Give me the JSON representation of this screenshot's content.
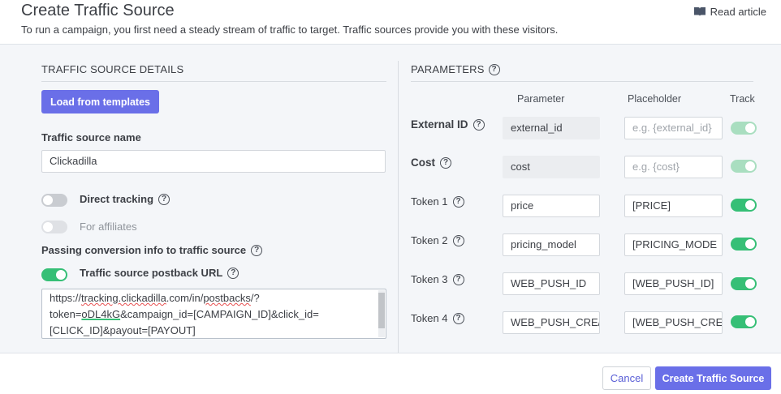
{
  "header": {
    "title": "Create Traffic Source",
    "subtitle": "To run a campaign, you first need a steady stream of traffic to target. Traffic sources provide you with these visitors.",
    "read_article": "Read article"
  },
  "details": {
    "section_title": "TRAFFIC SOURCE DETAILS",
    "load_button": "Load from templates",
    "name_label": "Traffic source name",
    "name_value": "Clickadilla",
    "direct_tracking_label": "Direct tracking",
    "for_affiliates_label": "For affiliates",
    "passing_label": "Passing conversion info to traffic source",
    "postback_label": "Traffic source postback URL",
    "postback_url": {
      "p1": "https://",
      "p2": "tracking.clickadilla",
      "p3": ".com/in/",
      "p4": "postbacks",
      "p5": "/?",
      "p6": "token=",
      "p7": "oDL4kG",
      "p8": "&campaign_id=[CAMPAIGN_ID]&click_id=",
      "p9": "[CLICK_ID]&payout=[PAYOUT]"
    },
    "toggles": {
      "direct_tracking": false,
      "for_affiliates": false,
      "postback": true
    }
  },
  "parameters": {
    "section_title": "PARAMETERS",
    "col_parameter": "Parameter",
    "col_placeholder": "Placeholder",
    "col_track": "Track",
    "rows": [
      {
        "label": "External ID",
        "parameter": "external_id",
        "placeholder": "",
        "placeholder_hint": "e.g. {external_id}",
        "track": true
      },
      {
        "label": "Cost",
        "parameter": "cost",
        "placeholder": "",
        "placeholder_hint": "e.g. {cost}",
        "track": true
      },
      {
        "label": "Token 1",
        "parameter": "price",
        "placeholder": "[PRICE]",
        "track": true
      },
      {
        "label": "Token 2",
        "parameter": "pricing_model",
        "placeholder": "[PRICING_MODE",
        "track": true
      },
      {
        "label": "Token 3",
        "parameter": "WEB_PUSH_ID",
        "placeholder": "[WEB_PUSH_ID]",
        "track": true
      },
      {
        "label": "Token 4",
        "parameter": "WEB_PUSH_CRE/",
        "placeholder": "[WEB_PUSH_CRE",
        "track": true
      }
    ]
  },
  "footer": {
    "cancel": "Cancel",
    "create": "Create Traffic Source"
  },
  "colors": {
    "primary": "#6a6fe8",
    "toggle_on": "#36bf76",
    "toggle_off": "#c9ccd1",
    "background": "#f4f6f9"
  }
}
